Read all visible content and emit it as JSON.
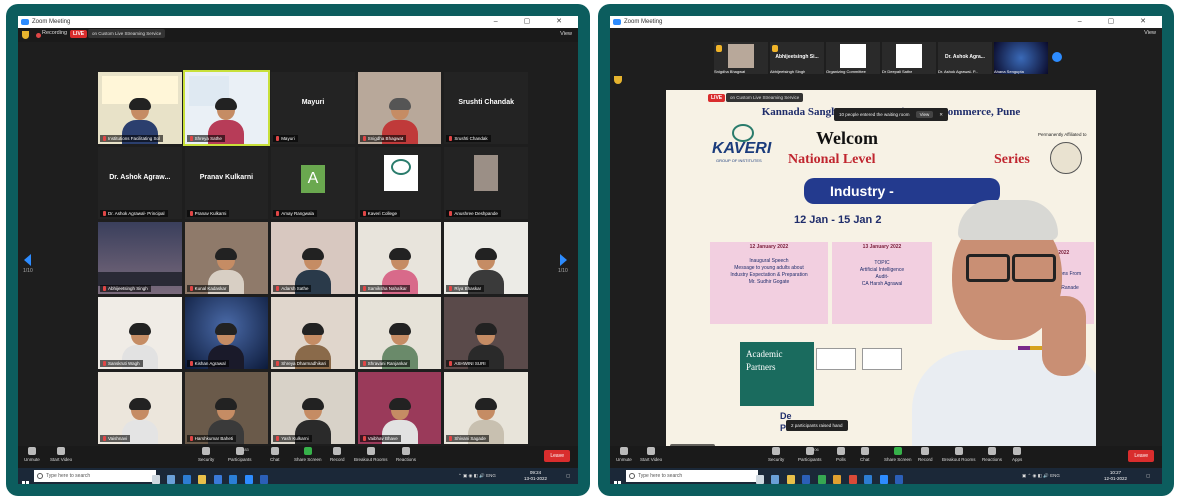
{
  "left": {
    "window_title": "Zoom Meeting",
    "recording_label": "Recording",
    "live_label": "LIVE",
    "stream_label": "on Custom Live Streaming Service",
    "view_label": "View",
    "page_left": "1/10",
    "page_right": "1/10",
    "tiles": [
      {
        "name": "Institutions Facilitating Sol",
        "big": ""
      },
      {
        "name": "Shreya Sathe",
        "big": ""
      },
      {
        "name": "Mayuri",
        "big": "Mayuri"
      },
      {
        "name": "Snigdha Bhagwat",
        "big": ""
      },
      {
        "name": "Srushti Chandak",
        "big": "Srushti Chandak"
      },
      {
        "name": "Dr. Ashok Agrawal- Principal",
        "big": "Dr. Ashok Agraw..."
      },
      {
        "name": "Pranav Kulkarni",
        "big": "Pranav Kulkarni"
      },
      {
        "name": "Amay Rangwala",
        "big": "",
        "avatar": "A"
      },
      {
        "name": "Kaveri College",
        "big": ""
      },
      {
        "name": "Anushree Deshpande",
        "big": ""
      },
      {
        "name": "Abhijeetsingh Singh",
        "big": ""
      },
      {
        "name": "Kunal Kadaskar",
        "big": ""
      },
      {
        "name": "Adarsh Sathe",
        "big": ""
      },
      {
        "name": "Samiksha Nahalkar",
        "big": ""
      },
      {
        "name": "Riya Bhaskar",
        "big": ""
      },
      {
        "name": "Sanskruti Wagh",
        "big": ""
      },
      {
        "name": "Kishan Agrawal",
        "big": ""
      },
      {
        "name": "Shreya Dharmadhikari",
        "big": ""
      },
      {
        "name": "Shravani Ranjankar",
        "big": ""
      },
      {
        "name": "ASHWINI SURI",
        "big": ""
      },
      {
        "name": "Vaishnavi",
        "big": ""
      },
      {
        "name": "Harshkumar Baheti",
        "big": ""
      },
      {
        "name": "Yash Kulkarni",
        "big": ""
      },
      {
        "name": "Vaibhav Bhave",
        "big": ""
      },
      {
        "name": "Shivani Sagade",
        "big": ""
      }
    ],
    "toolbar": {
      "unmute": "Unmute",
      "start_video": "Start Video",
      "security": "Security",
      "participants": "Participants",
      "participants_count": "183",
      "chat": "Chat",
      "share_screen": "Share Screen",
      "record": "Record",
      "breakout_rooms": "Breakout Rooms",
      "reactions": "Reactions",
      "leave": "Leave"
    },
    "taskbar": {
      "search_placeholder": "Type here to search",
      "lang": "ENG",
      "time": "09:24",
      "date": "13-01-2022"
    }
  },
  "right": {
    "window_title": "Zoom Meeting",
    "view_label": "View",
    "live_label": "LIVE",
    "stream_label": "on Custom Live Streaming Service",
    "waiting_toast": "10 people entered the waiting room",
    "waiting_view": "View",
    "raised_hand_toast": "2 participants raised hand",
    "speaker_label": "Snigdha Bhagwat",
    "strip": [
      {
        "label": "Snigdha Bhagwat",
        "title": ""
      },
      {
        "label": "Abhijeetsingh Singh",
        "title": "Abhijeetsingh Si..."
      },
      {
        "label": "Organizing Committee",
        "title": ""
      },
      {
        "label": "Dr Deepali Sathe",
        "title": ""
      },
      {
        "label": "Dr. Ashok Agrawal- P...",
        "title": "Dr. Ashok Agra..."
      },
      {
        "label": "Ahana Sengupta",
        "title": ""
      }
    ],
    "slide": {
      "org_line": "Kannada Sangha Pune's ... Science & Commerce, Pune",
      "kaveri": "KAVERI",
      "kaveri_sub": "GROUP OF INSTITUTES",
      "welcome": "Welcom",
      "national": "National Level",
      "series": "Series",
      "banner": "Industry -",
      "dates": "12 Jan - 15 Jan 2",
      "affiliation": "Permanently Affiliated to",
      "p1_date": "12 January 2022",
      "p1_text": "Inaugural Speech\nMessage to young adults about\nIndustry Expectation & Preparation\nMr. Sudhir Gogate",
      "p2_date": "13 January 2022",
      "p2_text": "TOPIC\nArtificial Intelligence\nAudit-\nCA Harsh Agrawal",
      "p3_date": "15 January 2022",
      "p3_text": "TOPIC\nManagement Lessons From\nCricket-\nCA Satchidanand Ranade",
      "partners": "Academic Partners",
      "de": "De\nPr"
    },
    "toolbar": {
      "unmute": "Unmute",
      "start_video": "Start Video",
      "security": "Security",
      "participants": "Participants",
      "participants_count": "206",
      "polls": "Polls",
      "chat": "Chat",
      "share_screen": "Share Screen",
      "record": "Record",
      "breakout_rooms": "Breakout Rooms",
      "reactions": "Reactions",
      "apps": "Apps",
      "leave": "Leave"
    },
    "taskbar": {
      "search_placeholder": "Type here to search",
      "lang": "ENG",
      "time": "10:27",
      "date": "12-01-2022"
    }
  },
  "colors": {
    "frame": "#0c5d5e",
    "zoom_bg": "#1e1e1e",
    "live_red": "#d92d2d",
    "share_green": "#36b24a",
    "speaker_outline": "#c8e03a"
  }
}
